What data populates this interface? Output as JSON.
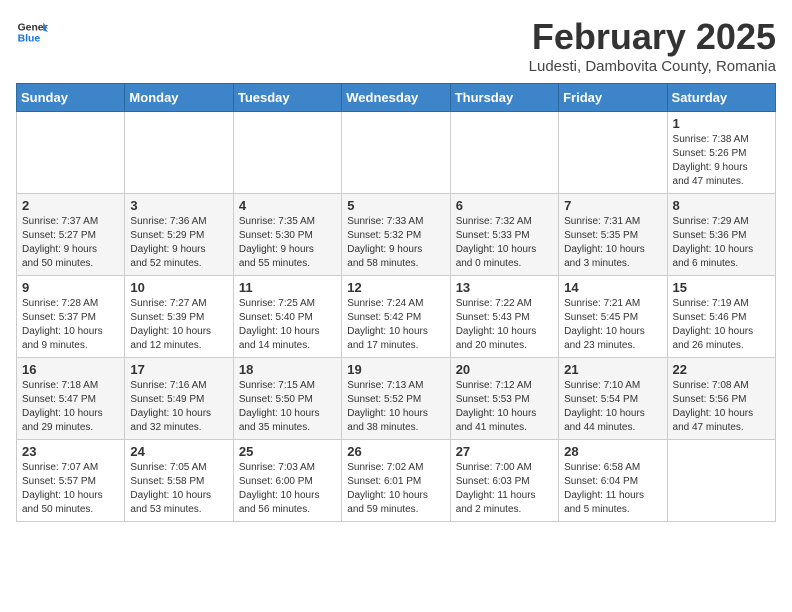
{
  "header": {
    "logo_line1": "General",
    "logo_line2": "Blue",
    "month_year": "February 2025",
    "location": "Ludesti, Dambovita County, Romania"
  },
  "weekdays": [
    "Sunday",
    "Monday",
    "Tuesday",
    "Wednesday",
    "Thursday",
    "Friday",
    "Saturday"
  ],
  "weeks": [
    [
      {
        "day": "",
        "info": ""
      },
      {
        "day": "",
        "info": ""
      },
      {
        "day": "",
        "info": ""
      },
      {
        "day": "",
        "info": ""
      },
      {
        "day": "",
        "info": ""
      },
      {
        "day": "",
        "info": ""
      },
      {
        "day": "1",
        "info": "Sunrise: 7:38 AM\nSunset: 5:26 PM\nDaylight: 9 hours\nand 47 minutes."
      }
    ],
    [
      {
        "day": "2",
        "info": "Sunrise: 7:37 AM\nSunset: 5:27 PM\nDaylight: 9 hours\nand 50 minutes."
      },
      {
        "day": "3",
        "info": "Sunrise: 7:36 AM\nSunset: 5:29 PM\nDaylight: 9 hours\nand 52 minutes."
      },
      {
        "day": "4",
        "info": "Sunrise: 7:35 AM\nSunset: 5:30 PM\nDaylight: 9 hours\nand 55 minutes."
      },
      {
        "day": "5",
        "info": "Sunrise: 7:33 AM\nSunset: 5:32 PM\nDaylight: 9 hours\nand 58 minutes."
      },
      {
        "day": "6",
        "info": "Sunrise: 7:32 AM\nSunset: 5:33 PM\nDaylight: 10 hours\nand 0 minutes."
      },
      {
        "day": "7",
        "info": "Sunrise: 7:31 AM\nSunset: 5:35 PM\nDaylight: 10 hours\nand 3 minutes."
      },
      {
        "day": "8",
        "info": "Sunrise: 7:29 AM\nSunset: 5:36 PM\nDaylight: 10 hours\nand 6 minutes."
      }
    ],
    [
      {
        "day": "9",
        "info": "Sunrise: 7:28 AM\nSunset: 5:37 PM\nDaylight: 10 hours\nand 9 minutes."
      },
      {
        "day": "10",
        "info": "Sunrise: 7:27 AM\nSunset: 5:39 PM\nDaylight: 10 hours\nand 12 minutes."
      },
      {
        "day": "11",
        "info": "Sunrise: 7:25 AM\nSunset: 5:40 PM\nDaylight: 10 hours\nand 14 minutes."
      },
      {
        "day": "12",
        "info": "Sunrise: 7:24 AM\nSunset: 5:42 PM\nDaylight: 10 hours\nand 17 minutes."
      },
      {
        "day": "13",
        "info": "Sunrise: 7:22 AM\nSunset: 5:43 PM\nDaylight: 10 hours\nand 20 minutes."
      },
      {
        "day": "14",
        "info": "Sunrise: 7:21 AM\nSunset: 5:45 PM\nDaylight: 10 hours\nand 23 minutes."
      },
      {
        "day": "15",
        "info": "Sunrise: 7:19 AM\nSunset: 5:46 PM\nDaylight: 10 hours\nand 26 minutes."
      }
    ],
    [
      {
        "day": "16",
        "info": "Sunrise: 7:18 AM\nSunset: 5:47 PM\nDaylight: 10 hours\nand 29 minutes."
      },
      {
        "day": "17",
        "info": "Sunrise: 7:16 AM\nSunset: 5:49 PM\nDaylight: 10 hours\nand 32 minutes."
      },
      {
        "day": "18",
        "info": "Sunrise: 7:15 AM\nSunset: 5:50 PM\nDaylight: 10 hours\nand 35 minutes."
      },
      {
        "day": "19",
        "info": "Sunrise: 7:13 AM\nSunset: 5:52 PM\nDaylight: 10 hours\nand 38 minutes."
      },
      {
        "day": "20",
        "info": "Sunrise: 7:12 AM\nSunset: 5:53 PM\nDaylight: 10 hours\nand 41 minutes."
      },
      {
        "day": "21",
        "info": "Sunrise: 7:10 AM\nSunset: 5:54 PM\nDaylight: 10 hours\nand 44 minutes."
      },
      {
        "day": "22",
        "info": "Sunrise: 7:08 AM\nSunset: 5:56 PM\nDaylight: 10 hours\nand 47 minutes."
      }
    ],
    [
      {
        "day": "23",
        "info": "Sunrise: 7:07 AM\nSunset: 5:57 PM\nDaylight: 10 hours\nand 50 minutes."
      },
      {
        "day": "24",
        "info": "Sunrise: 7:05 AM\nSunset: 5:58 PM\nDaylight: 10 hours\nand 53 minutes."
      },
      {
        "day": "25",
        "info": "Sunrise: 7:03 AM\nSunset: 6:00 PM\nDaylight: 10 hours\nand 56 minutes."
      },
      {
        "day": "26",
        "info": "Sunrise: 7:02 AM\nSunset: 6:01 PM\nDaylight: 10 hours\nand 59 minutes."
      },
      {
        "day": "27",
        "info": "Sunrise: 7:00 AM\nSunset: 6:03 PM\nDaylight: 11 hours\nand 2 minutes."
      },
      {
        "day": "28",
        "info": "Sunrise: 6:58 AM\nSunset: 6:04 PM\nDaylight: 11 hours\nand 5 minutes."
      },
      {
        "day": "",
        "info": ""
      }
    ]
  ]
}
